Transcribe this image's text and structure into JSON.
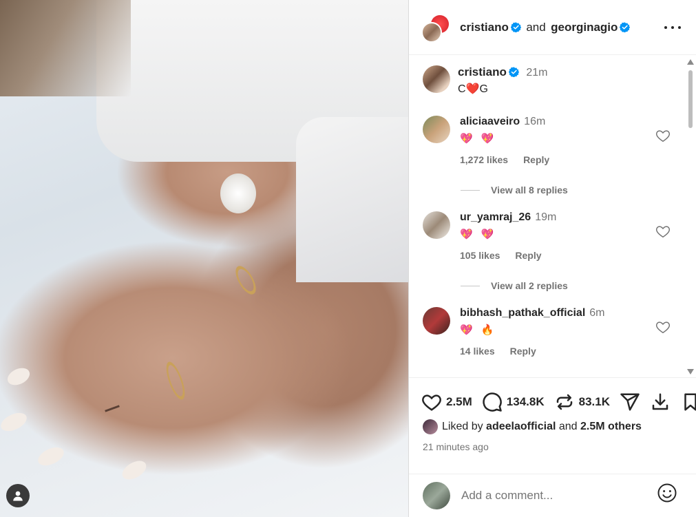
{
  "header": {
    "author1": "cristiano",
    "connector": "and",
    "author2": "georginagio"
  },
  "caption": {
    "username": "cristiano",
    "time": "21m",
    "text": "C❤️G"
  },
  "comments": [
    {
      "username": "aliciaaveiro",
      "time": "16m",
      "text": "💖 💖",
      "likes": "1,272 likes",
      "reply": "Reply",
      "view_replies": "View all 8 replies"
    },
    {
      "username": "ur_yamraj_26",
      "time": "19m",
      "text": "💖 💖",
      "likes": "105 likes",
      "reply": "Reply",
      "view_replies": "View all 2 replies"
    },
    {
      "username": "bibhash_pathak_official",
      "time": "6m",
      "text": "💖 🔥",
      "likes": "14 likes",
      "reply": "Reply"
    }
  ],
  "actions": {
    "likes_count": "2.5M",
    "comments_count": "134.8K",
    "reposts_count": "83.1K"
  },
  "liked_by": {
    "prefix": "Liked by",
    "user": "adeelaofficial",
    "middle": "and",
    "others": "2.5M others"
  },
  "posted": "21 minutes ago",
  "add_comment": {
    "placeholder": "Add a comment..."
  },
  "icons": [
    "verified-icon",
    "more-icon",
    "heart-icon",
    "comment-icon",
    "repost-icon",
    "share-icon",
    "download-icon",
    "bookmark-icon",
    "emoji-icon",
    "user-tag-icon"
  ],
  "colors": {
    "verified": "#0095f6",
    "heart_emoji": "#ff3040",
    "muted": "#737373"
  }
}
